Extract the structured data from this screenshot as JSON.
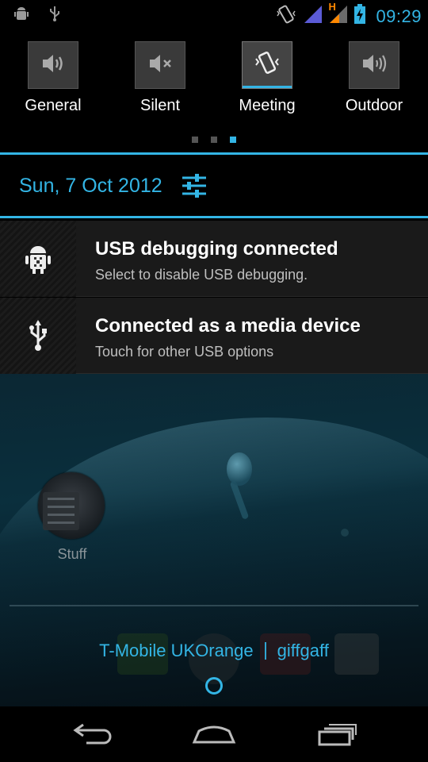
{
  "status_bar": {
    "time": "09:29",
    "network_type": "H",
    "left_icons": [
      "android-debug-icon",
      "usb-icon"
    ],
    "right_icons": [
      "vibrate-icon",
      "signal-icon",
      "signal-h-icon",
      "battery-charging-icon"
    ]
  },
  "profiles": [
    {
      "label": "General",
      "icon": "volume-icon",
      "active": false
    },
    {
      "label": "Silent",
      "icon": "mute-icon",
      "active": false
    },
    {
      "label": "Meeting",
      "icon": "vibrate-icon",
      "active": true
    },
    {
      "label": "Outdoor",
      "icon": "volume-loud-icon",
      "active": false
    }
  ],
  "pager": {
    "count": 3,
    "active_index": 2
  },
  "date": "Sun, 7 Oct 2012",
  "notifications": [
    {
      "title": "USB debugging connected",
      "subtitle": "Select to disable USB debugging.",
      "icon": "android-debug-icon"
    },
    {
      "title": "Connected as a media device",
      "subtitle": "Touch for other USB options",
      "icon": "usb-icon"
    }
  ],
  "home": {
    "folder_label": "Stuff"
  },
  "carrier": {
    "primary": "T-Mobile UKOrange",
    "secondary": "giffgaff"
  },
  "nav": [
    "back-icon",
    "home-icon",
    "recents-icon"
  ],
  "colors": {
    "accent": "#33b5e5",
    "background": "#000000",
    "notification_bg": "#1a1a1a"
  }
}
